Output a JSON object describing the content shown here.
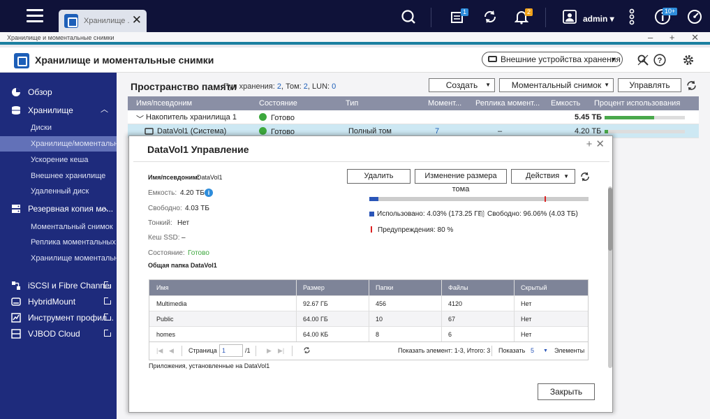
{
  "topbar": {
    "tab_label": "Хранилище ...",
    "tab_close": "✕",
    "tasks_badge": "1",
    "notifications_badge": "2",
    "user": "admin ▾",
    "dashboard_badge": "10+"
  },
  "window": {
    "title": "Хранилище и моментальные снимки",
    "controls": "‒ + ✕"
  },
  "app": {
    "title": "Хранилище и моментальные снимки",
    "external_storage_btn": "Внешние устройства хранения"
  },
  "sidebar": {
    "overview": "Обзор",
    "storage": "Хранилище",
    "disks": "Диски",
    "storage_snapshots": "Хранилище/моментальн...",
    "cache": "Ускорение кеша",
    "external": "Внешнее хранилище",
    "remote_disk": "Удаленный диск",
    "backup": "Резервная копия мо...",
    "snapshot": "Моментальный снимок",
    "snapshot_replica": "Реплика моментальных ...",
    "snapshot_vault": "Хранилище моментальн...",
    "iscsi": "iSCSI и Fibre Channel",
    "hybridmount": "HybridMount",
    "profiler": "Инструмент профил...",
    "vjbod": "VJBOD Cloud"
  },
  "content": {
    "title": "Пространство памяти",
    "sub_prefix": "Пул хранения:",
    "pool_count": "2",
    "vol_prefix": ", Том:",
    "vol_count": "2",
    "lun_prefix": ", LUN:",
    "lun_count": "0",
    "create_btn": "Создать",
    "snapshot_btn": "Моментальный снимок",
    "manage_btn": "Управлять",
    "columns": {
      "name": "Имя/псевдоним",
      "status": "Состояние",
      "type": "Тип",
      "snap": "Момент...",
      "replica": "Реплика момент...",
      "capacity": "Емкость",
      "usage": "Процент использования"
    },
    "pool_row": {
      "name": "Накопитель хранилища 1",
      "status": "Готово",
      "capacity": "5.45 ТБ",
      "usage": 0.62
    },
    "vol_row": {
      "name": "DataVol1 (Система)",
      "status": "Готово",
      "type": "Полный том",
      "snap": "7",
      "replica": "–",
      "capacity": "4.20 ТБ",
      "usage": 0.04
    }
  },
  "modal": {
    "title": "DataVol1  Управление",
    "name_label": "Имя/псевдоним:",
    "name_value": "DataVol1",
    "capacity_label": "Емкость:",
    "capacity_value": "4.20 ТБ",
    "free_label": "Свободно:",
    "free_value": "4.03 ТБ",
    "thin_label": "Тонкий:",
    "thin_value": "Нет",
    "ssd_label": "Кеш SSD:",
    "ssd_value": "–",
    "status_label": "Состояние:",
    "status_value": "Готово",
    "shared_label": "Общая папка DataVol1",
    "delete_btn": "Удалить",
    "resize_btn": "Изменение размера тома",
    "actions_btn": "Действия",
    "used_fraction": 0.0403,
    "warn_fraction": 0.8,
    "used_text": "Использовано: 4.03% (173.25 ГБ)",
    "free_text": "Свободно: 96.06% (4.03 ТБ)",
    "warn_text": "Предупреждения: 80 %",
    "table": {
      "columns": [
        "Имя",
        "Размер",
        "Папки",
        "Файлы",
        "Скрытый"
      ],
      "rows": [
        [
          "Multimedia",
          "92.67 ГБ",
          "456",
          "4120",
          "Нет"
        ],
        [
          "Public",
          "64.00 ГБ",
          "10",
          "67",
          "Нет"
        ],
        [
          "homes",
          "64.00 КБ",
          "8",
          "6",
          "Нет"
        ]
      ]
    },
    "pager": {
      "page_label": "Страница",
      "page_value": "1",
      "page_total": "/1",
      "summary": "Показать элемент: 1-3, Итого: 3",
      "show_label": "Показать",
      "show_value": "5",
      "items_label": "Элементы"
    },
    "apps_label": "Приложения, установленные на DataVol1",
    "close_btn": "Закрыть"
  },
  "colors": {
    "accent": "#1e2b7c",
    "topbar": "#0f1239",
    "ok": "#3da83d",
    "used": "#2a55b8",
    "warn": "#dd2222"
  }
}
